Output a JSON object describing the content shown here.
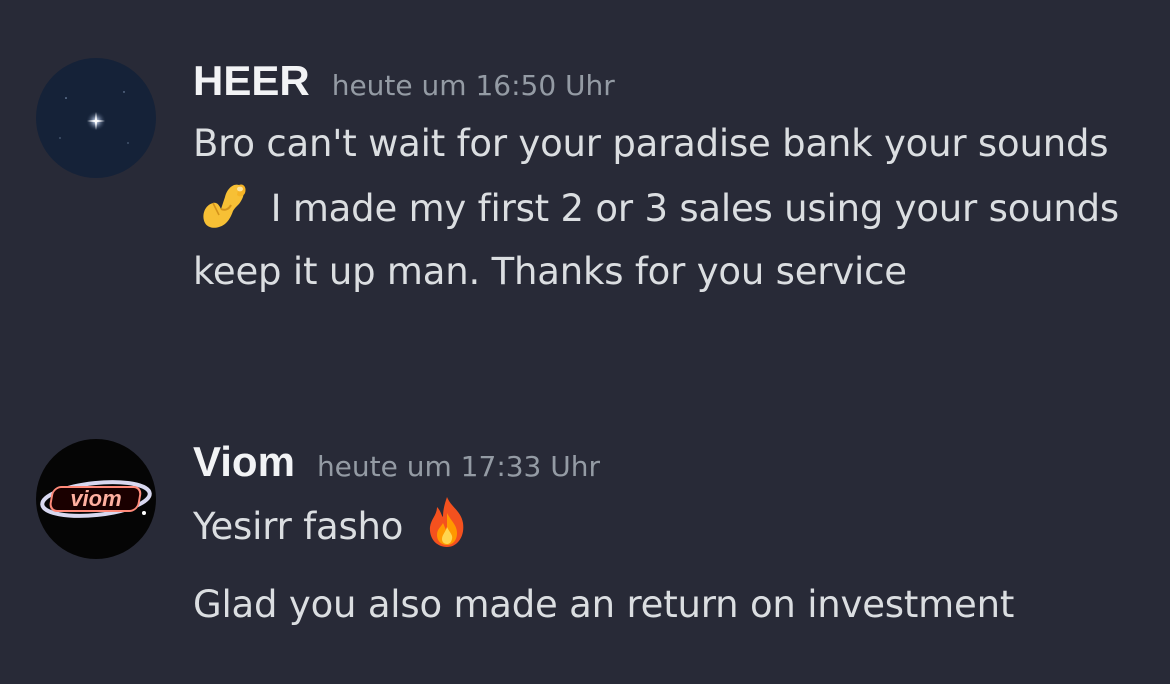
{
  "messages": [
    {
      "username": "HEER",
      "timestamp": "heute um 16:50 Uhr",
      "avatar": "star-night-avatar",
      "text_before_emoji": "Bro can't wait for your paradise bank your sounds",
      "emoji": "pinching-hand-emoji",
      "text_after_emoji": "I made my first 2 or 3 sales using your sounds keep it up man. Thanks for you service"
    },
    {
      "username": "Viom",
      "timestamp": "heute um 17:33 Uhr",
      "avatar": "viom-logo-avatar",
      "avatar_logo_text": "viom",
      "lines": [
        {
          "text": "Yesirr fasho",
          "emoji": "fire-emoji"
        },
        {
          "text": "Glad you also made an return on investment"
        }
      ]
    }
  ],
  "colors": {
    "background": "#282a37",
    "username": "#f2f3f5",
    "timestamp": "#949ba4",
    "message_text": "#dbdee1"
  }
}
